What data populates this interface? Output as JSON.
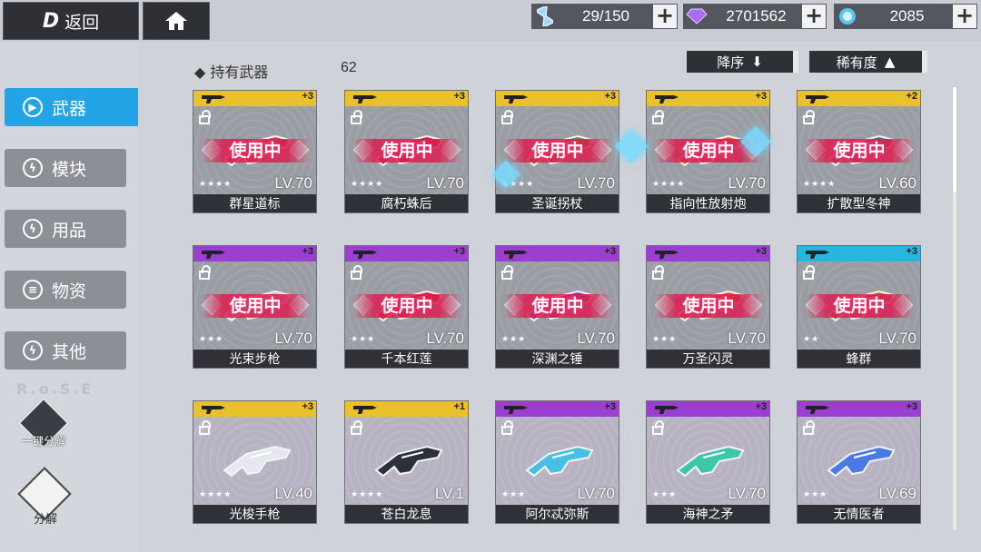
{
  "topbar": {
    "back_label": "返回",
    "back_glyph": "D",
    "home_icon": "home-icon",
    "resources": [
      {
        "name": "stamina",
        "icon": "hourglass-icon",
        "value": "29/150",
        "color": "#7fc6ff"
      },
      {
        "name": "crystal",
        "icon": "purple-gem-icon",
        "value": "2701562",
        "color": "#9b6cf0"
      },
      {
        "name": "energy",
        "icon": "blue-orb-icon",
        "value": "2085",
        "color": "#5cc8ff"
      }
    ],
    "plus_label": "+"
  },
  "sidebar": {
    "items": [
      {
        "label": "武器",
        "icon": "gun-icon",
        "active": true
      },
      {
        "label": "模块",
        "icon": "bolt-icon",
        "active": false
      },
      {
        "label": "用品",
        "icon": "bolt-icon",
        "active": false
      },
      {
        "label": "物资",
        "icon": "supplies-icon",
        "active": false
      },
      {
        "label": "其他",
        "icon": "bolt-icon",
        "active": false
      }
    ],
    "watermark": "R.o.S.E",
    "quick_dismantle_label": "一键分解",
    "dismantle_label": "分解"
  },
  "header": {
    "held_label": "◆  持有武器",
    "held_count": "62",
    "sort_desc_label": "降序",
    "sort_rarity_label": "稀有度"
  },
  "colors": {
    "gold": "#e9c22b",
    "purple": "#9b3fd0",
    "cyan": "#27b6dd",
    "active_tab": "#23a4e6",
    "in_use": "#e0205c"
  },
  "cards": [
    {
      "name": "群星道标",
      "level": "LV.70",
      "plus": "+3",
      "stars": "★★★★",
      "rarity": "gold",
      "in_use": true,
      "in_use_label": "使用中"
    },
    {
      "name": "腐朽蛛后",
      "level": "LV.70",
      "plus": "+3",
      "stars": "★★★★",
      "rarity": "gold",
      "in_use": true,
      "in_use_label": "使用中"
    },
    {
      "name": "圣诞拐杖",
      "level": "LV.70",
      "plus": "+3",
      "stars": "★★★★",
      "rarity": "gold",
      "in_use": true,
      "in_use_label": "使用中"
    },
    {
      "name": "指向性放射炮",
      "level": "LV.70",
      "plus": "+3",
      "stars": "★★★★",
      "rarity": "gold",
      "in_use": true,
      "in_use_label": "使用中"
    },
    {
      "name": "扩散型冬神",
      "level": "LV.60",
      "plus": "+2",
      "stars": "★★★★",
      "rarity": "gold",
      "in_use": true,
      "in_use_label": "使用中"
    },
    {
      "name": "光束步枪",
      "level": "LV.70",
      "plus": "+3",
      "stars": "★★★",
      "rarity": "purple",
      "in_use": true,
      "in_use_label": "使用中"
    },
    {
      "name": "千本红莲",
      "level": "LV.70",
      "plus": "+3",
      "stars": "★★★",
      "rarity": "purple",
      "in_use": true,
      "in_use_label": "使用中"
    },
    {
      "name": "深渊之锤",
      "level": "LV.70",
      "plus": "+3",
      "stars": "★★★",
      "rarity": "purple",
      "in_use": true,
      "in_use_label": "使用中"
    },
    {
      "name": "万圣闪灵",
      "level": "LV.70",
      "plus": "+3",
      "stars": "★★★",
      "rarity": "purple",
      "in_use": true,
      "in_use_label": "使用中"
    },
    {
      "name": "蜂群",
      "level": "LV.70",
      "plus": "+3",
      "stars": "★★",
      "rarity": "cyan",
      "in_use": true,
      "in_use_label": "使用中"
    },
    {
      "name": "光梭手枪",
      "level": "LV.40",
      "plus": "+3",
      "stars": "★★★★",
      "rarity": "gold",
      "in_use": false,
      "in_use_label": ""
    },
    {
      "name": "苍白龙息",
      "level": "LV.1",
      "plus": "+1",
      "stars": "★★★★",
      "rarity": "gold",
      "in_use": false,
      "in_use_label": ""
    },
    {
      "name": "阿尔忒弥斯",
      "level": "LV.70",
      "plus": "+3",
      "stars": "★★★",
      "rarity": "purple",
      "in_use": false,
      "in_use_label": ""
    },
    {
      "name": "海神之矛",
      "level": "LV.70",
      "plus": "+3",
      "stars": "★★★",
      "rarity": "purple",
      "in_use": false,
      "in_use_label": ""
    },
    {
      "name": "无情医者",
      "level": "LV.69",
      "plus": "+3",
      "stars": "★★★",
      "rarity": "purple",
      "in_use": false,
      "in_use_label": ""
    }
  ]
}
